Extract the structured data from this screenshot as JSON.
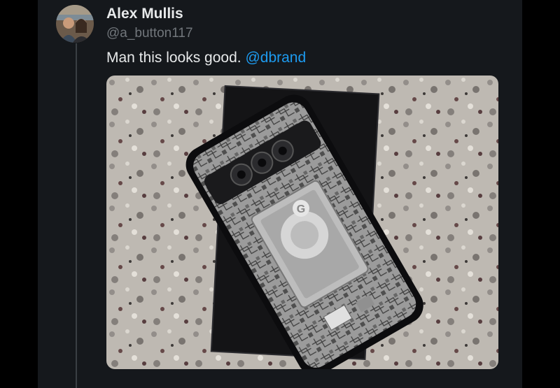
{
  "tweet": {
    "author": {
      "display_name": "Alex Mullis",
      "handle": "@a_button117"
    },
    "text": "Man this looks good. ",
    "mention": "@dbrand",
    "media": {
      "subject": "photo",
      "icon": "google-g-logo"
    }
  },
  "colors": {
    "background": "#000000",
    "column": "#15181c",
    "text": "#e7e9ea",
    "secondary": "#71767b",
    "link": "#1d9bf0"
  }
}
